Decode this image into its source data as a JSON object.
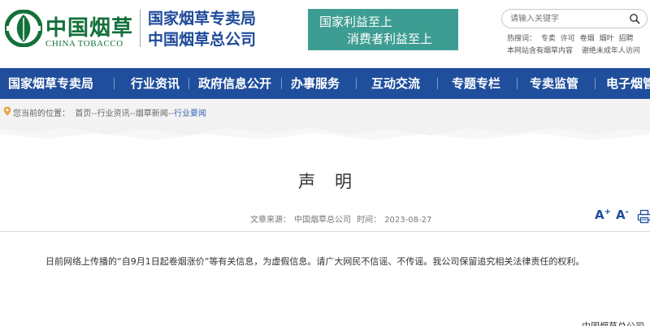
{
  "header": {
    "logo_cn": "中国烟草",
    "logo_en": "CHINA TOBACCO",
    "org_line1": "国家烟草专卖局",
    "org_line2": "中国烟草总公司",
    "slogan_line1": "国家利益至上",
    "slogan_line2": "消费者利益至上",
    "search_placeholder": "请输入关键字",
    "hot_words": [
      "热搜词：",
      "专卖",
      "许可",
      "卷烟",
      "烟叶",
      "招聘"
    ],
    "notice_items": [
      "本网站含有烟草内容",
      "谢绝未成年人访问"
    ],
    "brand_green": "#13703a",
    "brand_blue": "#1e4a9a",
    "slogan_bg": "#3e9d92"
  },
  "nav": {
    "items": [
      "国家烟草专卖局",
      "行业资讯",
      "政府信息公开",
      "办事服务",
      "互动交流",
      "专题专栏",
      "专卖监管",
      "电子烟管"
    ],
    "bg_color": "#1f4e9c"
  },
  "breadcrumb": {
    "prefix": "您当前的位置：",
    "items": [
      "首页",
      "行业资讯",
      "烟草新闻",
      "行业要闻"
    ],
    "separator": "--"
  },
  "article": {
    "title": "声明",
    "source_label": "文章来源：",
    "source": "中国烟草总公司",
    "time_label": "时间：",
    "time": "2023-08-27",
    "font_large": "A",
    "font_large_sup": "+",
    "font_small": "A",
    "font_small_sup": "-",
    "content": "日前网络上传播的“自9月1日起卷烟涨价”等有关信息，为虚假信息。请广大网民不信谣、不传谣。我公司保留追究相关法律责任的权利。",
    "signature": "中国烟草总公司"
  },
  "icons": {
    "search": "search-icon",
    "pin": "location-pin-icon",
    "print": "printer-icon",
    "emblem": "china-tobacco-emblem-icon"
  }
}
